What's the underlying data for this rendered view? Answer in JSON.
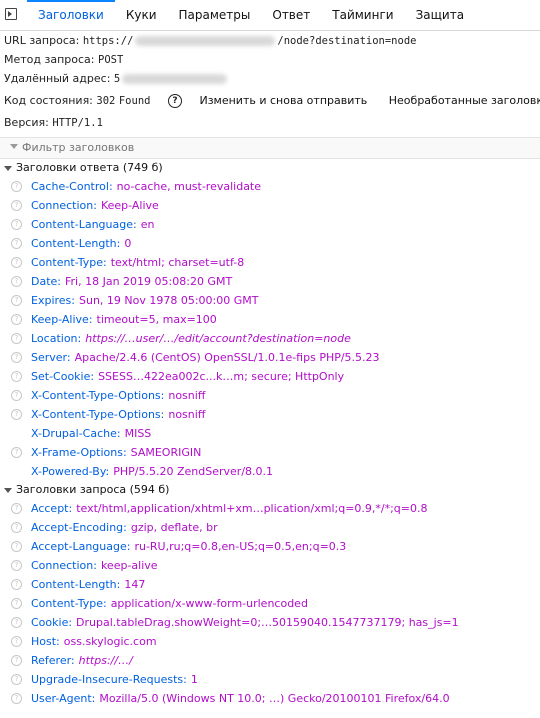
{
  "tabs": [
    "Заголовки",
    "Куки",
    "Параметры",
    "Ответ",
    "Тайминги",
    "Защита"
  ],
  "summary": {
    "url_label": "URL запроса:",
    "url_prefix": "https://",
    "url_suffix": "/node?destination=node",
    "method_label": "Метод запроса:",
    "method_value": "POST",
    "remote_label": "Удалённый адрес:",
    "remote_value_visible": "5",
    "status_label": "Код состояния:",
    "status_code": "302",
    "status_text": "Found",
    "help_glyph": "?",
    "edit_resend": "Изменить и снова отправить",
    "raw_headers": "Необработанные заголовки",
    "version_label": "Версия:",
    "version_value": "HTTP/1.1"
  },
  "filter": {
    "placeholder": "Фильтр заголовков"
  },
  "response_section": {
    "title": "Заголовки ответа (749 б)",
    "headers": [
      {
        "name": "Cache-Control:",
        "value": "no-cache, must-revalidate",
        "help": true
      },
      {
        "name": "Connection:",
        "value": "Keep-Alive",
        "help": true
      },
      {
        "name": "Content-Language:",
        "value": "en",
        "help": true
      },
      {
        "name": "Content-Length:",
        "value": "0",
        "help": true
      },
      {
        "name": "Content-Type:",
        "value": "text/html; charset=utf-8",
        "help": true
      },
      {
        "name": "Date:",
        "value": "Fri, 18 Jan 2019 05:08:20 GMT",
        "help": true
      },
      {
        "name": "Expires:",
        "value": "Sun, 19 Nov 1978 05:00:00 GMT",
        "help": true
      },
      {
        "name": "Keep-Alive:",
        "value": "timeout=5, max=100",
        "help": true
      },
      {
        "name": "Location:",
        "value": "https://…user/…/edit/account?destination=node",
        "help": true,
        "italic": true
      },
      {
        "name": "Server:",
        "value": "Apache/2.4.6 (CentOS) OpenSSL/1.0.1e-fips PHP/5.5.23",
        "help": true
      },
      {
        "name": "Set-Cookie:",
        "value": "SSESS…422ea002c...k…m; secure; HttpOnly",
        "help": true
      },
      {
        "name": "X-Content-Type-Options:",
        "value": "nosniff",
        "help": true
      },
      {
        "name": "X-Content-Type-Options:",
        "value": "nosniff",
        "help": true
      },
      {
        "name": "X-Drupal-Cache:",
        "value": "MISS",
        "help": false
      },
      {
        "name": "X-Frame-Options:",
        "value": "SAMEORIGIN",
        "help": true
      },
      {
        "name": "X-Powered-By:",
        "value": "PHP/5.5.20 ZendServer/8.0.1",
        "help": false
      }
    ]
  },
  "request_section": {
    "title": "Заголовки запроса (594 б)",
    "headers": [
      {
        "name": "Accept:",
        "value": "text/html,application/xhtml+xm…plication/xml;q=0.9,*/*;q=0.8",
        "help": true
      },
      {
        "name": "Accept-Encoding:",
        "value": "gzip, deflate, br",
        "help": true
      },
      {
        "name": "Accept-Language:",
        "value": "ru-RU,ru;q=0.8,en-US;q=0.5,en;q=0.3",
        "help": true
      },
      {
        "name": "Connection:",
        "value": "keep-alive",
        "help": true
      },
      {
        "name": "Content-Length:",
        "value": "147",
        "help": true
      },
      {
        "name": "Content-Type:",
        "value": "application/x-www-form-urlencoded",
        "help": true
      },
      {
        "name": "Cookie:",
        "value": "Drupal.tableDrag.showWeight=0;…50159040.1547737179; has_js=1",
        "help": true
      },
      {
        "name": "Host:",
        "value": "oss.skylogic.com",
        "help": true
      },
      {
        "name": "Referer:",
        "value": "https://…/",
        "help": true,
        "italic": true
      },
      {
        "name": "Upgrade-Insecure-Requests:",
        "value": "1",
        "help": true
      },
      {
        "name": "User-Agent:",
        "value": "Mozilla/5.0 (Windows NT 10.0; …) Gecko/20100101 Firefox/64.0",
        "help": true
      }
    ]
  },
  "colors": {
    "accent": "#0a84ff",
    "header_name": "#0060df",
    "header_value": "#b10dc9"
  },
  "icons": {
    "dock": "dock-side-icon",
    "help": "help-circle-icon",
    "filter": "filter-icon",
    "twisty": "twisty-down-icon"
  }
}
